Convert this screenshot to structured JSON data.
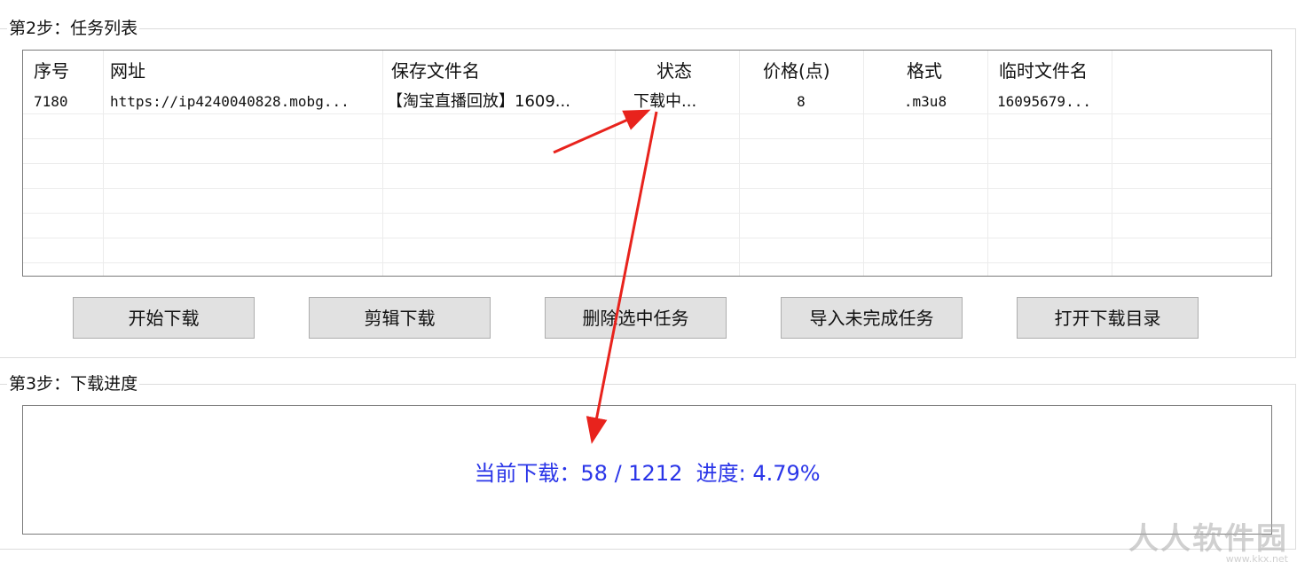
{
  "step2": {
    "title": "第2步：任务列表",
    "columns": [
      "序号",
      "网址",
      "保存文件名",
      "状态",
      "价格(点)",
      "格式",
      "临时文件名"
    ],
    "rows": [
      {
        "index": "7180",
        "url": "https://ip4240040828.mobg...",
        "save_name": "【淘宝直播回放】1609...",
        "status": "下载中...",
        "price": "8",
        "format": ".m3u8",
        "temp_name": "16095679..."
      }
    ]
  },
  "buttons": {
    "start": "开始下载",
    "clip": "剪辑下载",
    "delete": "删除选中任务",
    "import": "导入未完成任务",
    "open_dir": "打开下载目录"
  },
  "step3": {
    "title": "第3步：下载进度",
    "progress_text": "当前下载：58 / 1212  进度: 4.79%",
    "current": 58,
    "total": 1212,
    "percent": 4.79
  },
  "annotation": {
    "color": "#e8231d"
  },
  "watermark": {
    "text": "人人软件园",
    "url": "www.kkx.net"
  }
}
